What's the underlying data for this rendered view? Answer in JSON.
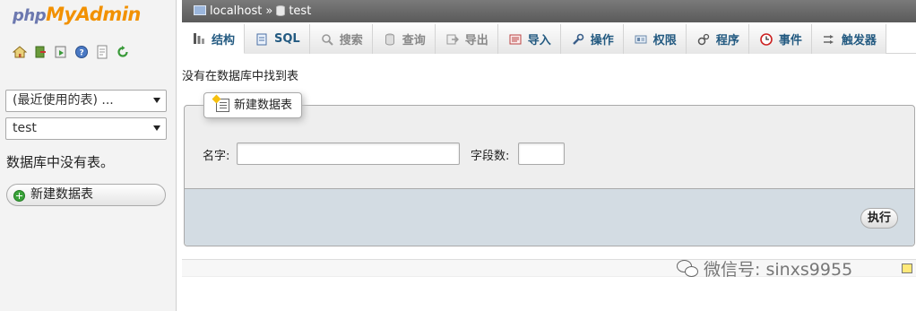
{
  "nav": {
    "logo_php": "php",
    "logo_myadmin": "MyAdmin",
    "icons": [
      "home-icon",
      "exit-icon",
      "query-window-icon",
      "help-icon",
      "docs-icon",
      "reload-icon"
    ],
    "recent_tables": "(最近使用的表) ...",
    "database": "test",
    "empty_message": "数据库中没有表。",
    "new_table_label": "新建数据表"
  },
  "breadcrumb": {
    "server": "localhost",
    "separator": "»",
    "database": "test"
  },
  "tabs": [
    {
      "label": "结构",
      "icon": "structure-icon",
      "active": true,
      "disabled": false
    },
    {
      "label": "SQL",
      "icon": "sql-icon",
      "active": false,
      "disabled": false
    },
    {
      "label": "搜索",
      "icon": "search-icon",
      "active": false,
      "disabled": true
    },
    {
      "label": "查询",
      "icon": "query-icon",
      "active": false,
      "disabled": true
    },
    {
      "label": "导出",
      "icon": "export-icon",
      "active": false,
      "disabled": true
    },
    {
      "label": "导入",
      "icon": "import-icon",
      "active": false,
      "disabled": false
    },
    {
      "label": "操作",
      "icon": "wrench-icon",
      "active": false,
      "disabled": false
    },
    {
      "label": "权限",
      "icon": "privileges-icon",
      "active": false,
      "disabled": false
    },
    {
      "label": "程序",
      "icon": "routines-icon",
      "active": false,
      "disabled": false
    },
    {
      "label": "事件",
      "icon": "clock-icon",
      "active": false,
      "disabled": false
    },
    {
      "label": "触发器",
      "icon": "triggers-icon",
      "active": false,
      "disabled": false
    }
  ],
  "main": {
    "not_found": "没有在数据库中找到表",
    "create_legend": "新建数据表",
    "name_label": "名字:",
    "name_value": "",
    "columns_label": "字段数:",
    "columns_value": "",
    "go_label": "执行"
  },
  "watermark": "微信号: sinxs9955",
  "colors": {
    "link": "#235a81",
    "logo_php": "#6c78af",
    "logo_myadmin": "#f29100",
    "breadcrumb_bg": "#666666",
    "footer_bg": "#d3dce3"
  }
}
